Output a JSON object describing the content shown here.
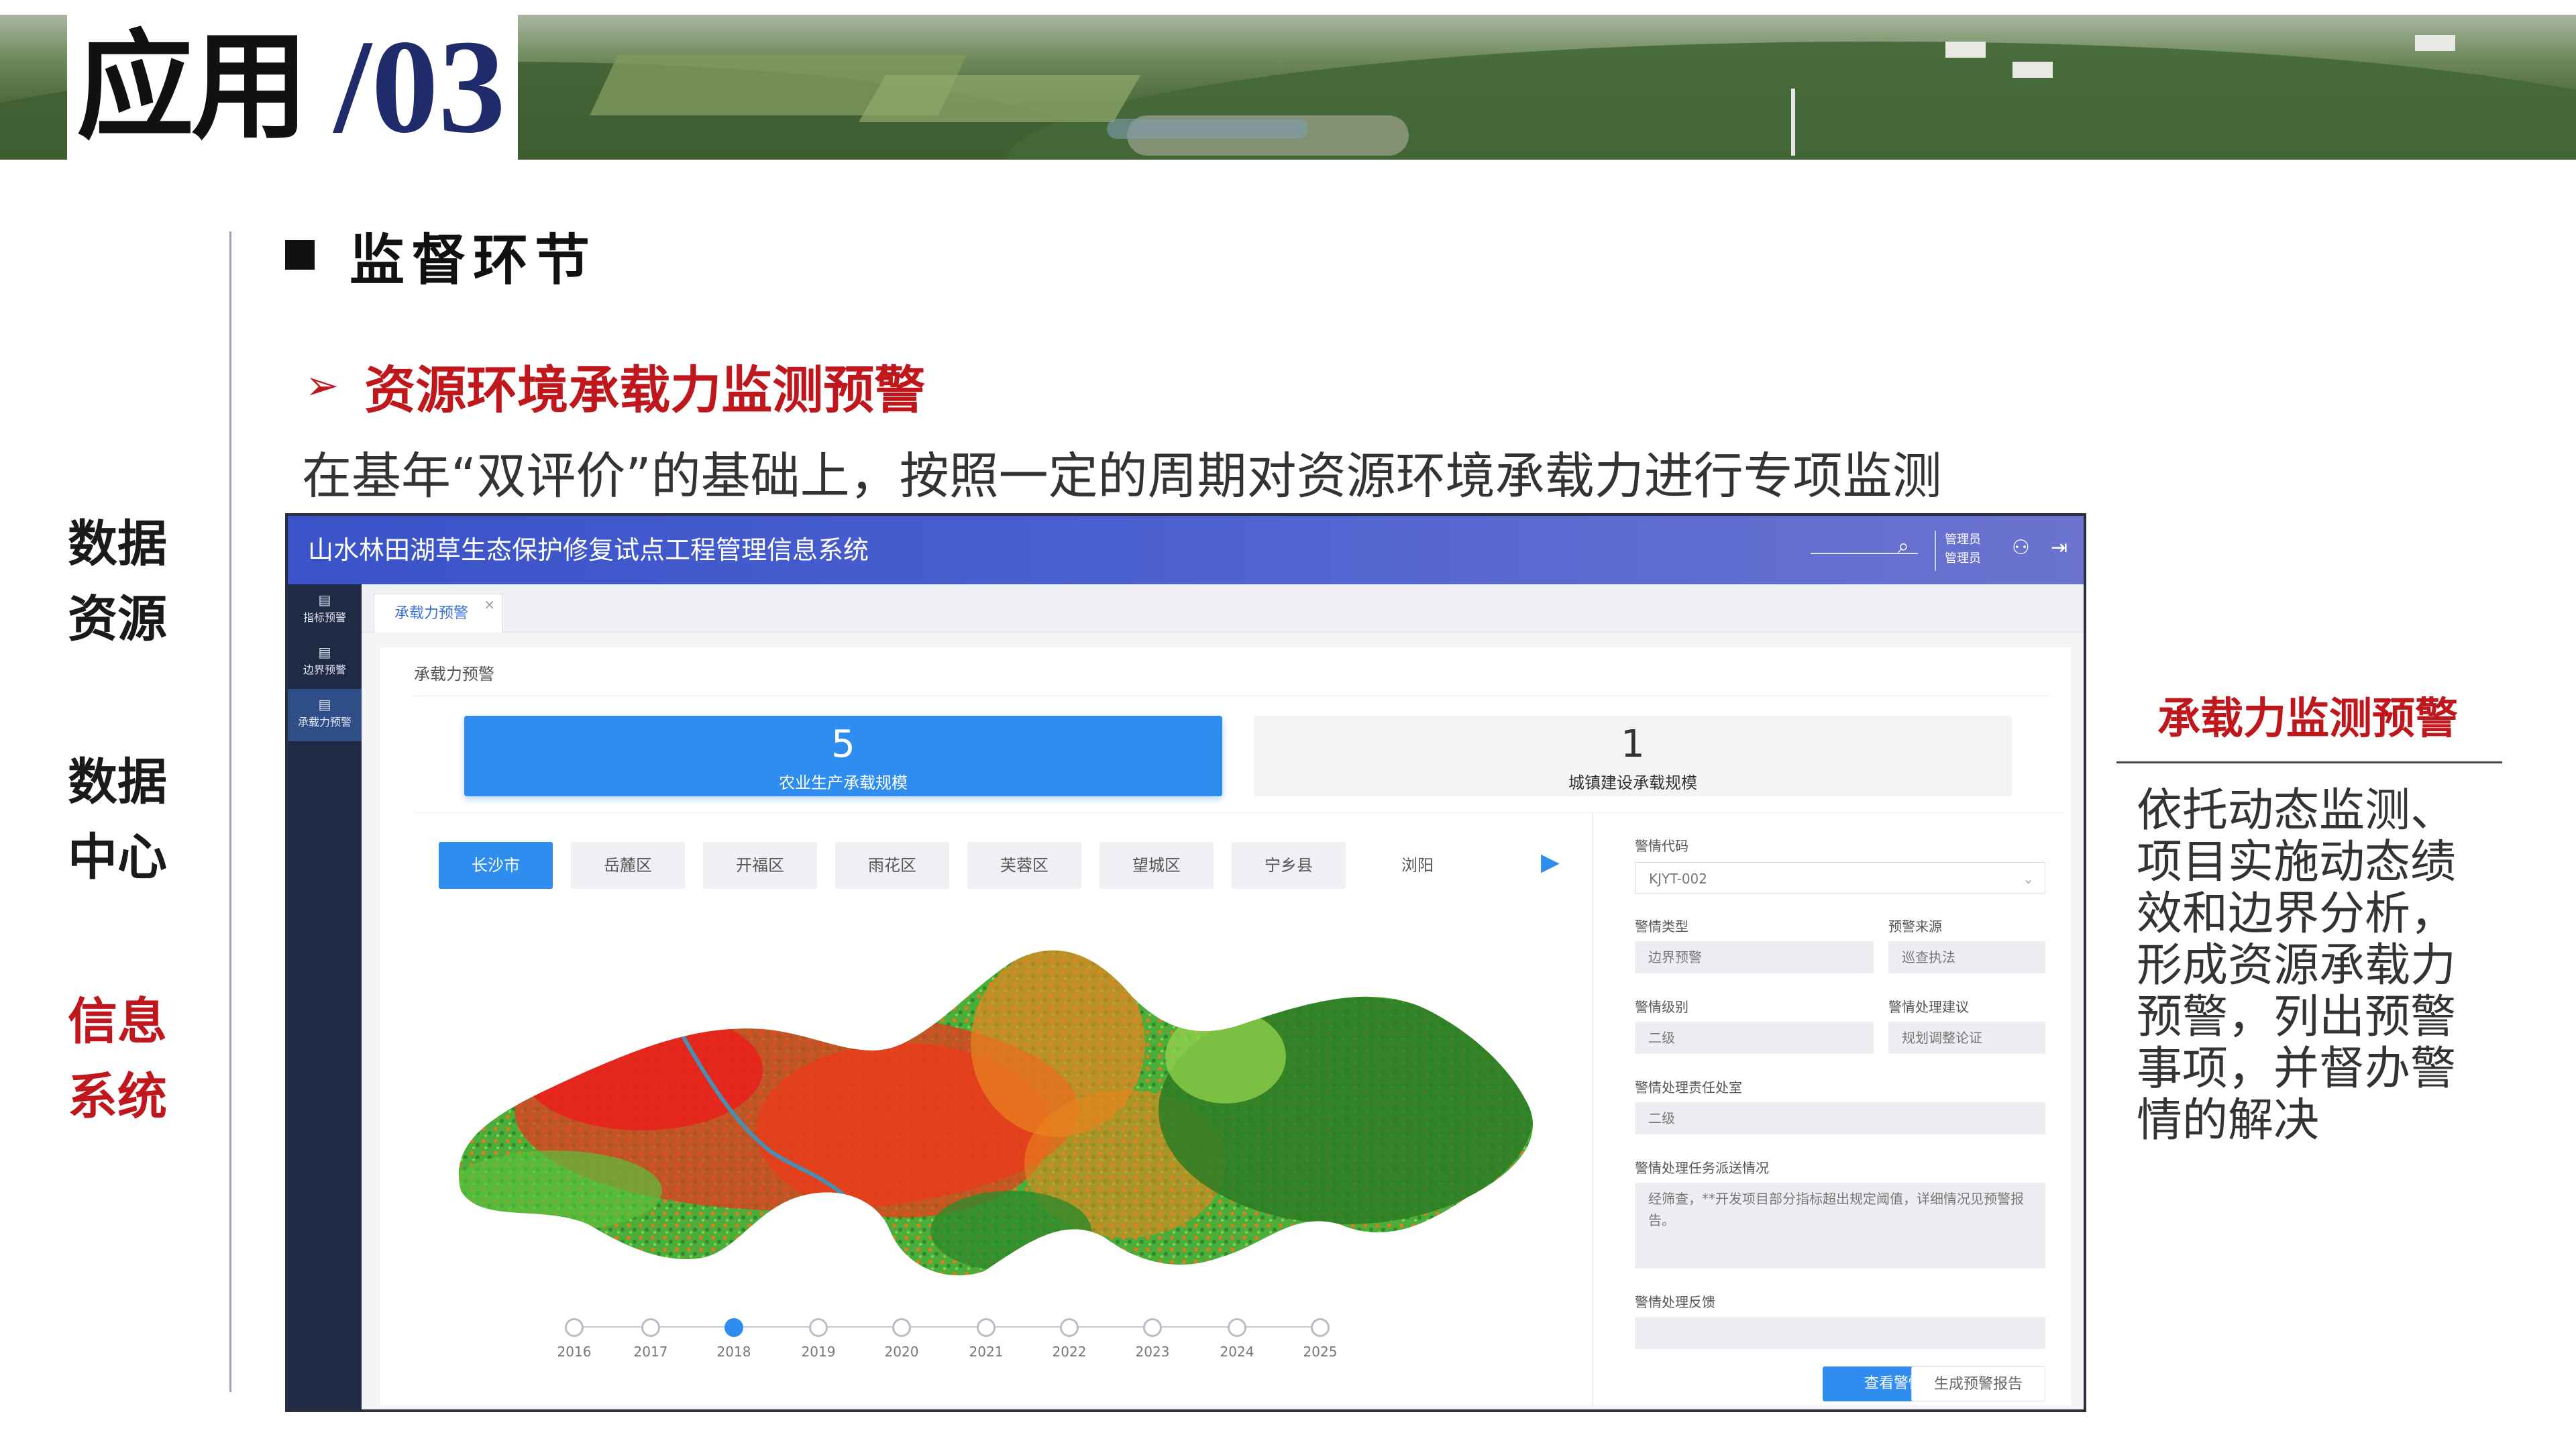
{
  "banner": {
    "title_cn": "应用",
    "title_num": "/03"
  },
  "side_nav": [
    {
      "label": "数据资源",
      "lines": [
        "数据",
        "资源"
      ],
      "active": false
    },
    {
      "label": "数据中心",
      "lines": [
        "数据",
        "中心"
      ],
      "active": false
    },
    {
      "label": "信息系统",
      "lines": [
        "信息",
        "系统"
      ],
      "active": true
    }
  ],
  "section": {
    "title": "监督环节",
    "subtitle": "资源环境承载力监测预警",
    "description": "在基年“双评价”的基础上，按照一定的周期对资源环境承载力进行专项监测"
  },
  "app": {
    "title": "山水林田湖草生态保护修复试点工程管理信息系统",
    "user_lines": [
      "管理员",
      "管理员"
    ],
    "menu": [
      {
        "label": "指标预警",
        "active": false
      },
      {
        "label": "边界预警",
        "active": false
      },
      {
        "label": "承载力预警",
        "active": true
      }
    ],
    "tab": "承载力预警",
    "panel_title": "承载力预警",
    "stats": [
      {
        "value": "5",
        "label": "农业生产承载规模"
      },
      {
        "value": "1",
        "label": "城镇建设承载规模"
      }
    ],
    "districts": [
      "长沙市",
      "岳麓区",
      "开福区",
      "雨花区",
      "芙蓉区",
      "望城区",
      "宁乡县",
      "浏阳"
    ],
    "years": [
      "2016",
      "2017",
      "2018",
      "2019",
      "2020",
      "2021",
      "2022",
      "2023",
      "2024",
      "2025"
    ],
    "active_year": "2018",
    "form": {
      "code_label": "警情代码",
      "code_value": "KJYT-002",
      "type_label": "警情类型",
      "type_value": "边界预警",
      "source_label": "预警来源",
      "source_value": "巡查执法",
      "level_label": "警情级别",
      "level_value": "二级",
      "advice_label": "警情处理建议",
      "advice_value": "规划调整论证",
      "office_label": "警情处理责任处室",
      "office_value": "二级",
      "dispatch_label": "警情处理任务派送情况",
      "dispatch_value": "经筛查，**开发项目部分指标超出规定阈值，详细情况见预警报告。",
      "feedback_label": "警情处理反馈",
      "feedback_value": "",
      "btn_view": "查看警情",
      "btn_report": "生成预警报告"
    }
  },
  "callout": {
    "title": "承载力监测预警",
    "text": "依托动态监测、项目实施动态绩效和边界分析，形成资源承载力预警，列出预警事项，并督办警情的解决"
  },
  "colors": {
    "accent_red": "#c0171d",
    "primary_blue": "#2f8df0",
    "header_blue": "#3a53c8"
  }
}
